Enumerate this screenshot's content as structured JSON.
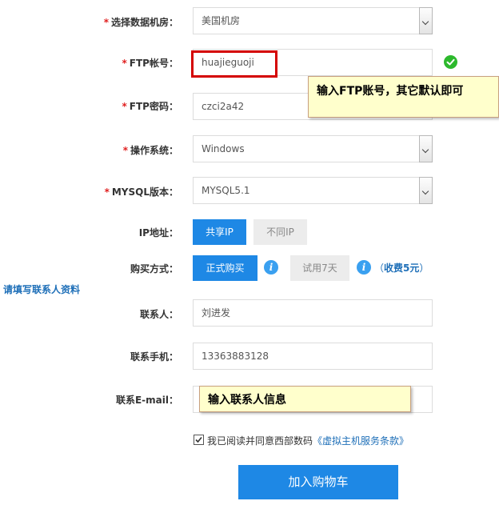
{
  "datacenter": {
    "label": "选择数据机房",
    "value": "美国机房"
  },
  "ftp_account": {
    "label": "FTP帐号",
    "value": "huajieguoji"
  },
  "ftp_password": {
    "label": "FTP密码",
    "value": "czci2a42"
  },
  "os": {
    "label": "操作系统",
    "value": "Windows"
  },
  "mysql": {
    "label": "MYSQL版本",
    "value": "MYSQL5.1"
  },
  "ip": {
    "label": "IP地址",
    "shared": "共享IP",
    "dedicated": "不同IP"
  },
  "purchase": {
    "label": "购买方式",
    "formal": "正式购买",
    "trial": "试用7天",
    "fee": "收费5元",
    "paren_open": "（",
    "paren_close": "）"
  },
  "contact_prompt": "请填写联系人资料",
  "contact": {
    "label": "联系人",
    "value": "刘进发"
  },
  "phone": {
    "label": "联系手机",
    "value": "13363883128"
  },
  "email": {
    "label": "联系E-mail",
    "value": ""
  },
  "colon": "：",
  "required_mark": "*",
  "agreement": {
    "text": "我已阅读并同意西部数码",
    "link": "《虚拟主机服务条款》",
    "checked": true
  },
  "submit": "加入购物车",
  "callouts": {
    "ftp": "输入FTP账号，其它默认即可",
    "contact": "输入联系人信息"
  },
  "colors": {
    "primary": "#1e88e5",
    "required": "#e02020",
    "link": "#1e6fb8",
    "success": "#2db92d",
    "callout_bg": "#ffffcc",
    "highlight_border": "#d40000"
  }
}
